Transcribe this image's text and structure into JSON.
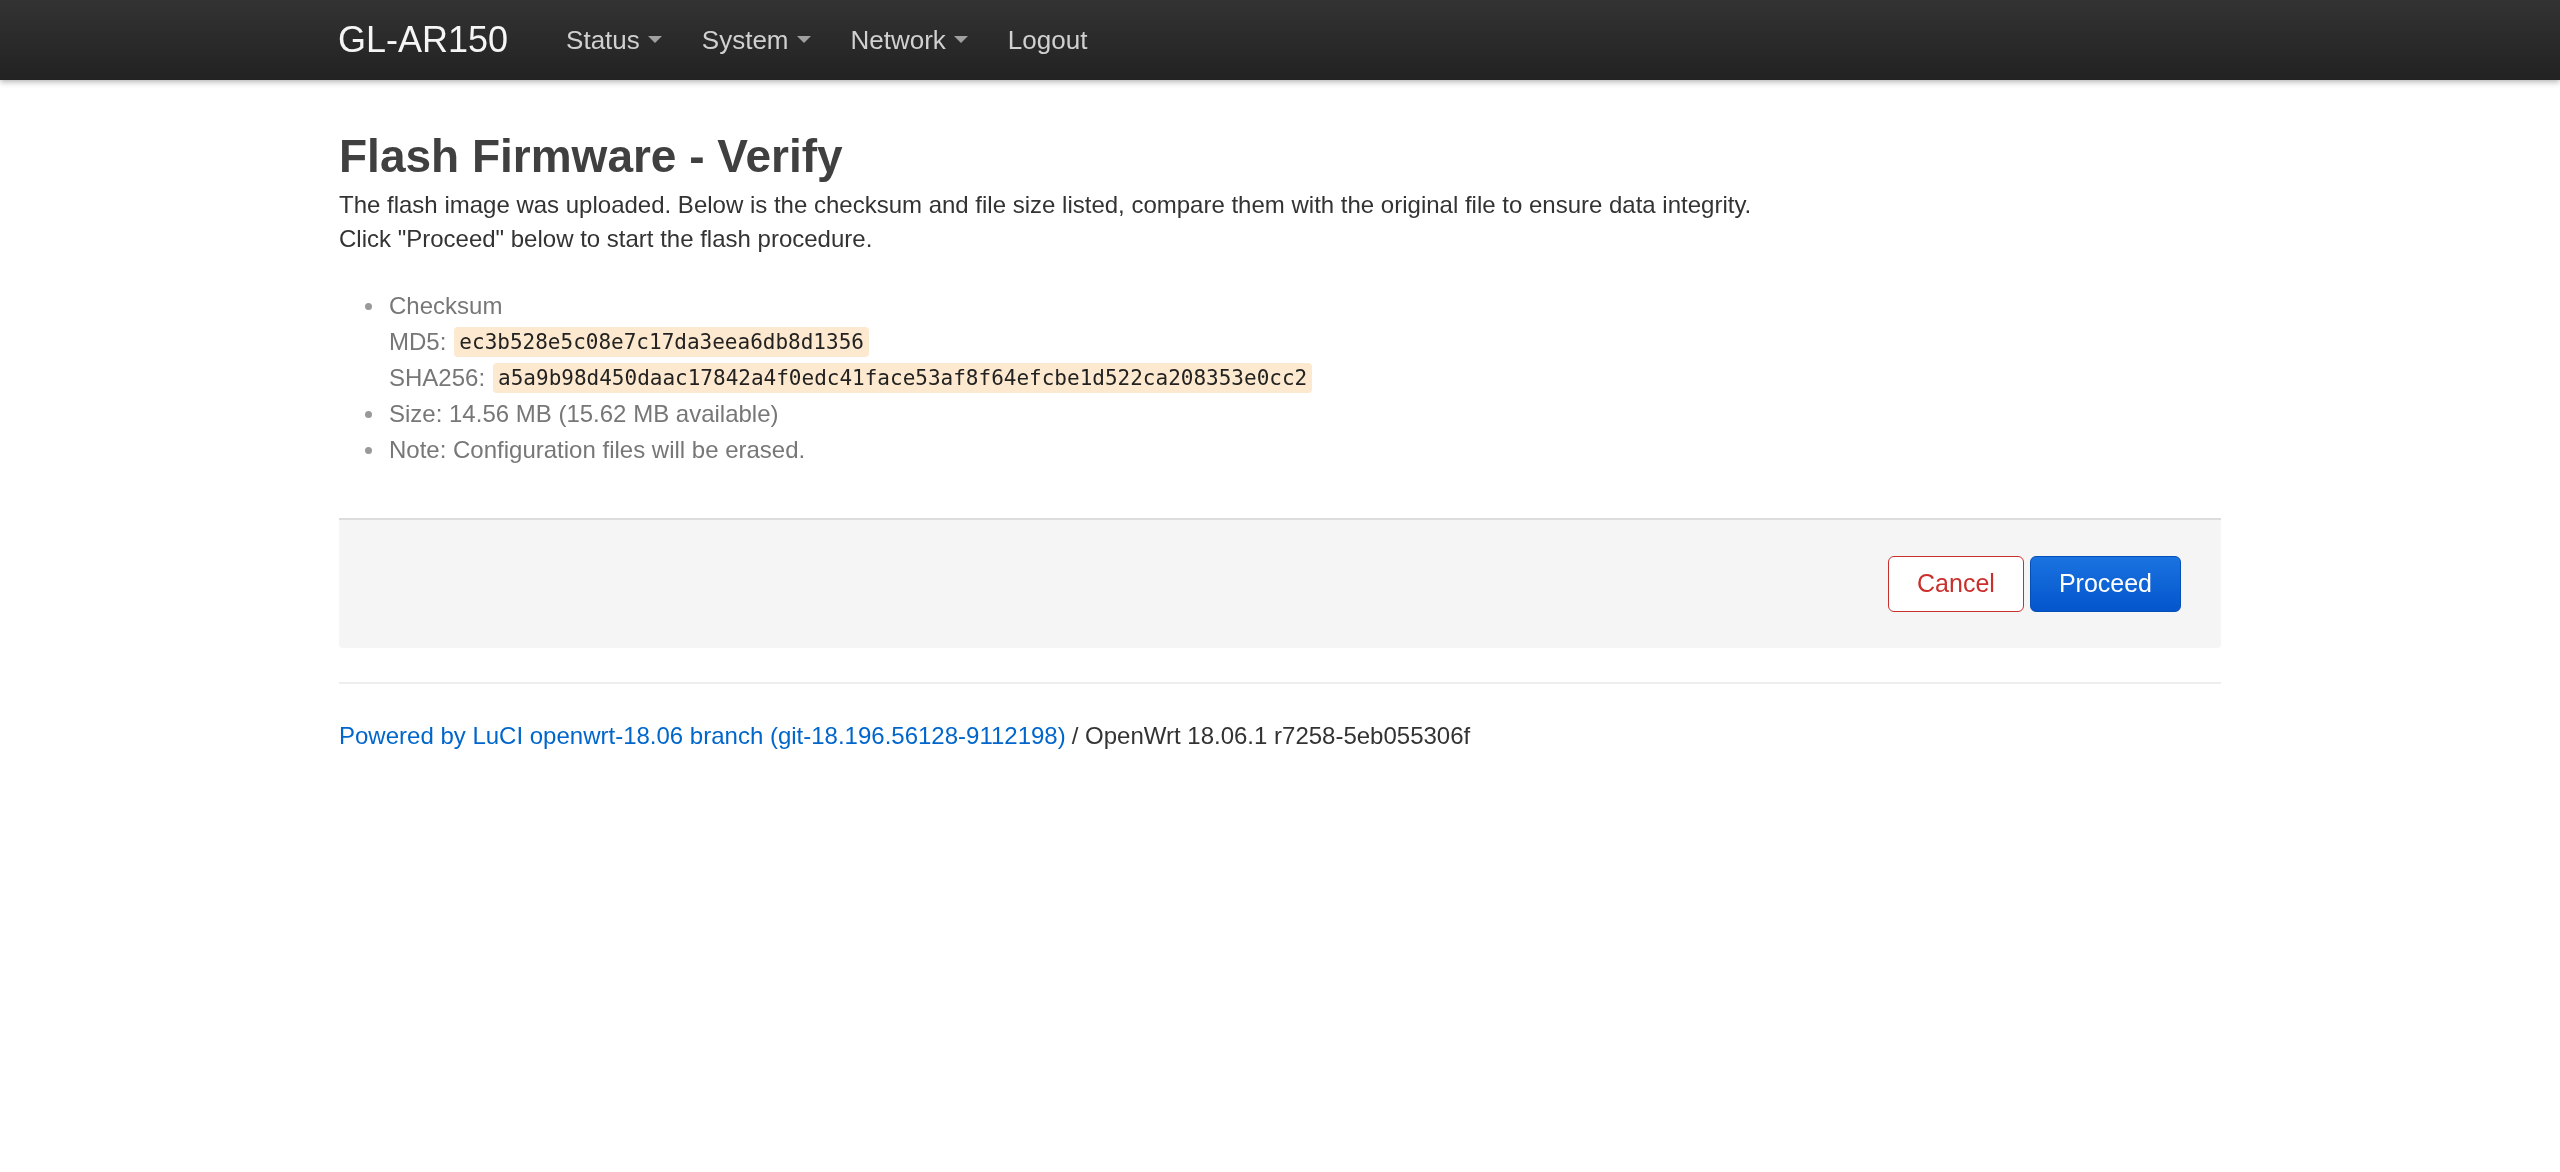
{
  "navbar": {
    "brand": "GL-AR150",
    "items": [
      {
        "label": "Status",
        "dropdown": true
      },
      {
        "label": "System",
        "dropdown": true
      },
      {
        "label": "Network",
        "dropdown": true
      },
      {
        "label": "Logout",
        "dropdown": false
      }
    ]
  },
  "title": "Flash Firmware - Verify",
  "description": [
    "The flash image was uploaded. Below is the checksum and file size listed, compare them with the original file to ensure data integrity.",
    "Click \"Proceed\" below to start the flash procedure."
  ],
  "details": [
    {
      "kind": "checksum",
      "label": "Checksum",
      "hashes": [
        {
          "label": "MD5:",
          "value": "ec3b528e5c08e7c17da3eea6db8d1356"
        },
        {
          "label": "SHA256:",
          "value": "a5a9b98d450daac17842a4f0edc41face53af8f64efcbe1d522ca208353e0cc2"
        }
      ]
    },
    {
      "kind": "text",
      "text": "Size: 14.56 MB (15.62 MB available)"
    },
    {
      "kind": "text",
      "text": "Note: Configuration files will be erased."
    }
  ],
  "actions": [
    {
      "label": "Cancel",
      "kind": "negative"
    },
    {
      "label": "Proceed",
      "kind": "primary"
    }
  ],
  "footer": {
    "link": "Powered by LuCI openwrt-18.06 branch (git-18.196.56128-9112198)",
    "text": "/ OpenWrt 18.06.1 r7258-5eb055306f"
  }
}
